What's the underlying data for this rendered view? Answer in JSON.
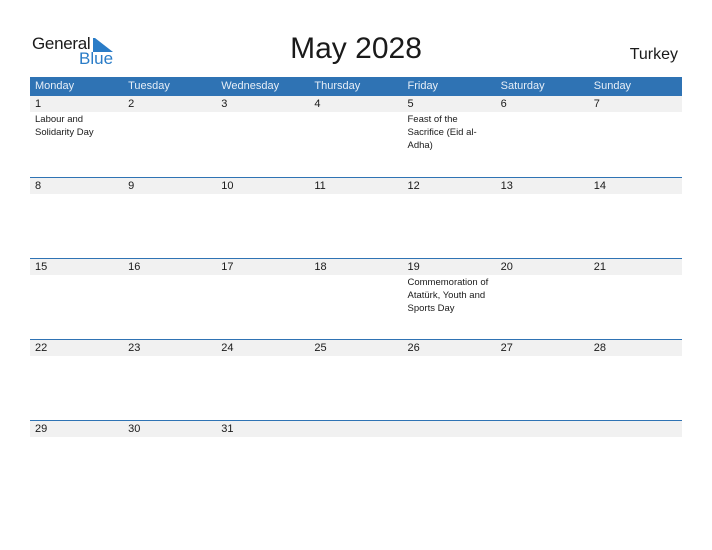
{
  "logo": {
    "general": "General",
    "blue": "Blue"
  },
  "title": "May 2028",
  "country": "Turkey",
  "weekdays": [
    "Monday",
    "Tuesday",
    "Wednesday",
    "Thursday",
    "Friday",
    "Saturday",
    "Sunday"
  ],
  "weeks": [
    {
      "days": [
        "1",
        "2",
        "3",
        "4",
        "5",
        "6",
        "7"
      ],
      "events": [
        "Labour and Solidarity Day",
        "",
        "",
        "",
        "Feast of the Sacrifice (Eid al-Adha)",
        "",
        ""
      ]
    },
    {
      "days": [
        "8",
        "9",
        "10",
        "11",
        "12",
        "13",
        "14"
      ],
      "events": [
        "",
        "",
        "",
        "",
        "",
        "",
        ""
      ]
    },
    {
      "days": [
        "15",
        "16",
        "17",
        "18",
        "19",
        "20",
        "21"
      ],
      "events": [
        "",
        "",
        "",
        "",
        "Commemoration of Atatürk, Youth and Sports Day",
        "",
        ""
      ]
    },
    {
      "days": [
        "22",
        "23",
        "24",
        "25",
        "26",
        "27",
        "28"
      ],
      "events": [
        "",
        "",
        "",
        "",
        "",
        "",
        ""
      ]
    },
    {
      "days": [
        "29",
        "30",
        "31",
        "",
        "",
        "",
        ""
      ],
      "events": [
        "",
        "",
        "",
        "",
        "",
        "",
        ""
      ]
    }
  ]
}
